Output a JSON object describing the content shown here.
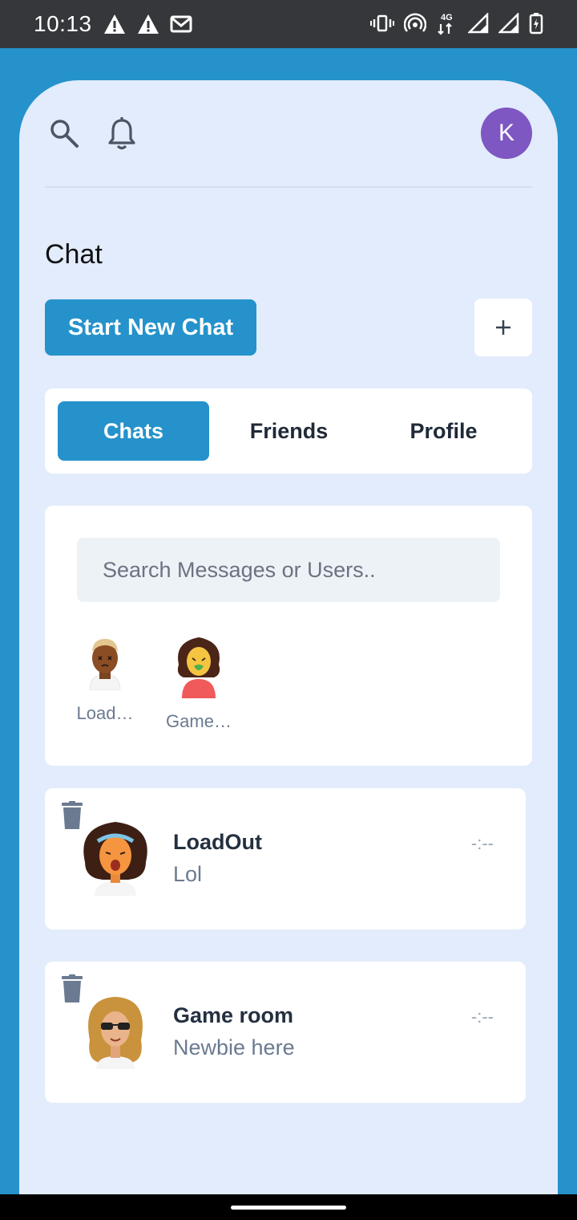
{
  "status_bar": {
    "time": "10:13",
    "network": "4G"
  },
  "header": {
    "avatar_letter": "K"
  },
  "page": {
    "title": "Chat",
    "start_button": "Start New Chat",
    "add_button": "+"
  },
  "tabs": [
    {
      "label": "Chats",
      "active": true
    },
    {
      "label": "Friends",
      "active": false
    },
    {
      "label": "Profile",
      "active": false
    }
  ],
  "search": {
    "placeholder": "Search Messages or Users.."
  },
  "online_users": [
    {
      "name": "Load…"
    },
    {
      "name": "Game…"
    }
  ],
  "chats": [
    {
      "name": "LoadOut",
      "message": "Lol",
      "time": "-:--"
    },
    {
      "name": "Game room",
      "message": "Newbie here",
      "time": "-:--"
    }
  ],
  "colors": {
    "accent": "#2592cb",
    "background": "#e2ecfc",
    "avatar": "#7e57c2"
  }
}
